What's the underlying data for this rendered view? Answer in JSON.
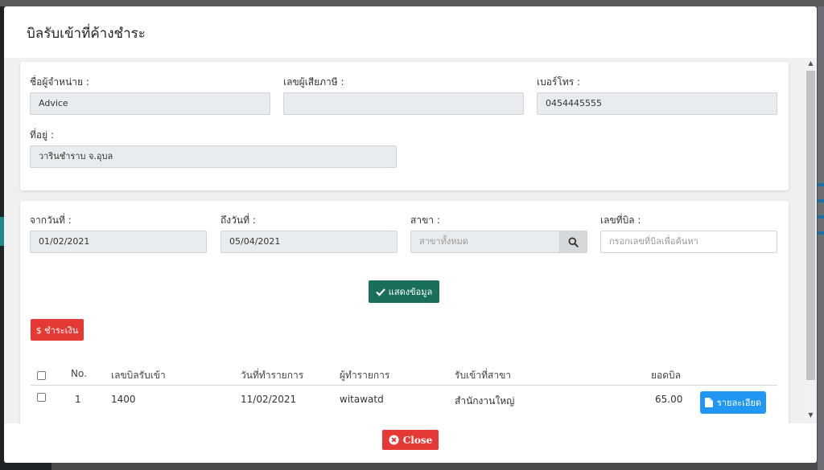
{
  "modal": {
    "title": "บิลรับเข้าที่ค้างชำระ"
  },
  "vendor": {
    "name_label": "ชื่อผู้จำหน่าย :",
    "name_value": "Advice",
    "tax_label": "เลขผู้เสียภาษี :",
    "tax_value": "",
    "phone_label": "เบอร์โทร :",
    "phone_value": "0454445555",
    "address_label": "ที่อยู่ :",
    "address_value": "วารินชำราบ จ.อุบล"
  },
  "filters": {
    "from_label": "จากวันที่ :",
    "from_value": "01/02/2021",
    "to_label": "ถึงวันที่ :",
    "to_value": "05/04/2021",
    "branch_label": "สาขา :",
    "branch_placeholder": "สาขาทั้งหมด",
    "bill_label": "เลขที่บิล :",
    "bill_placeholder": "กรอกเลขที่บิลเพื่อค้นหา"
  },
  "actions": {
    "show_label": "แสดงข้อมูล",
    "pay_label": "$ ชำระเงิน",
    "close_label": "Close",
    "detail_label": "รายละเอียด"
  },
  "table": {
    "headers": {
      "no": "No.",
      "bill_no": "เลขบิลรับเข้า",
      "date": "วันที่ทำรายการ",
      "user": "ผู้ทำรายการ",
      "branch": "รับเข้าที่สาขา",
      "total": "ยอดบิล"
    },
    "rows": [
      {
        "no": "1",
        "bill_no": "1400",
        "date": "11/02/2021",
        "user": "witawatd",
        "branch": "สำนักงานใหญ่",
        "total": "65.00"
      }
    ]
  },
  "colors": {
    "show_button": "#1a6f5c",
    "pay_button": "#e53935",
    "close_button": "#e53935",
    "detail_button": "#2196f3"
  },
  "icons": {
    "search": "search-icon",
    "check": "check-icon",
    "file": "file-icon",
    "close": "times-circle-icon"
  }
}
